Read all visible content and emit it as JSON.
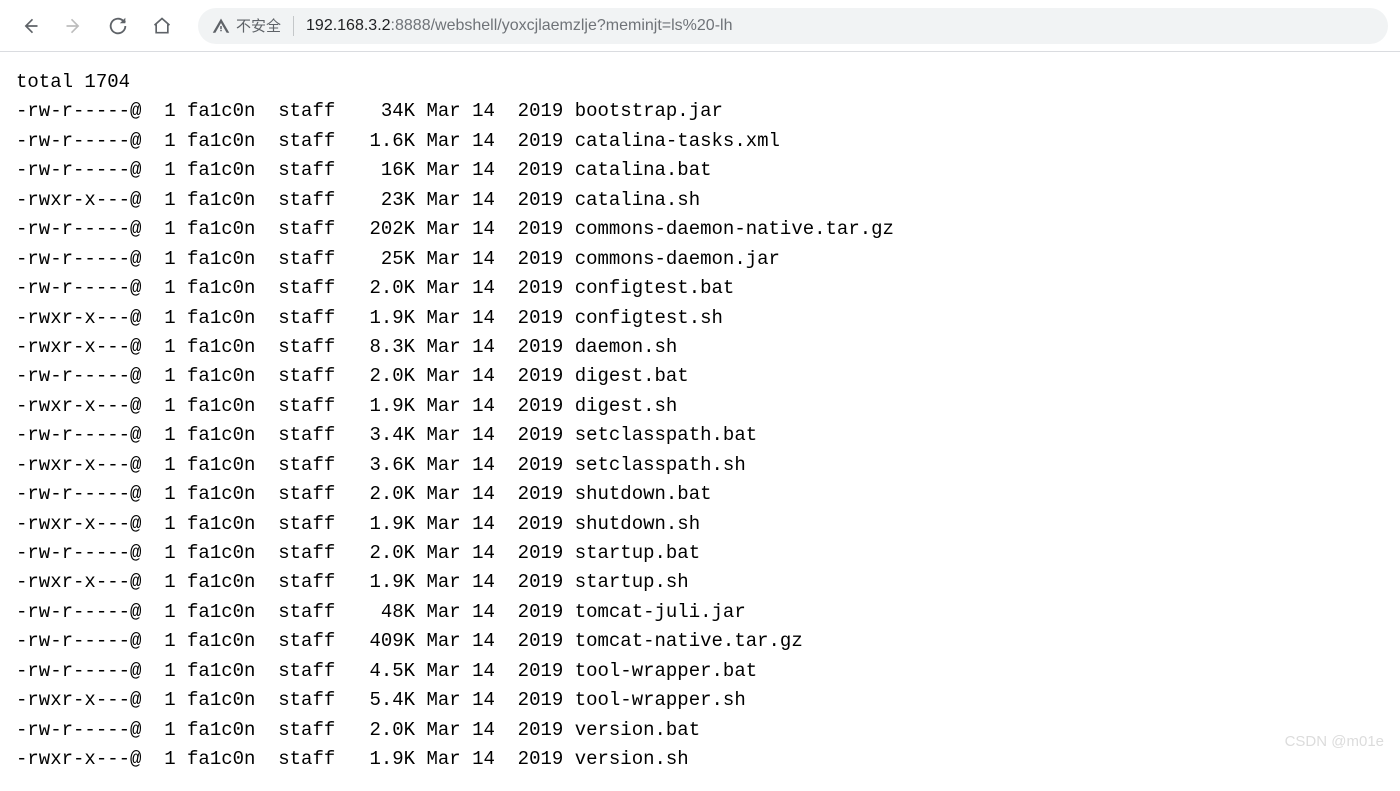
{
  "toolbar": {
    "insecure_label": "不安全",
    "url_host": "192.168.3.2",
    "url_rest": ":8888/webshell/yoxcjlaemzlje?meminjt=ls%20-lh"
  },
  "listing": {
    "total_line": "total 1704",
    "rows": [
      {
        "perm": "-rw-r-----@",
        "links": "1",
        "owner": "fa1c0n",
        "group": "staff",
        "size": "34K",
        "month": "Mar",
        "day": "14",
        "year": "2019",
        "name": "bootstrap.jar"
      },
      {
        "perm": "-rw-r-----@",
        "links": "1",
        "owner": "fa1c0n",
        "group": "staff",
        "size": "1.6K",
        "month": "Mar",
        "day": "14",
        "year": "2019",
        "name": "catalina-tasks.xml"
      },
      {
        "perm": "-rw-r-----@",
        "links": "1",
        "owner": "fa1c0n",
        "group": "staff",
        "size": "16K",
        "month": "Mar",
        "day": "14",
        "year": "2019",
        "name": "catalina.bat"
      },
      {
        "perm": "-rwxr-x---@",
        "links": "1",
        "owner": "fa1c0n",
        "group": "staff",
        "size": "23K",
        "month": "Mar",
        "day": "14",
        "year": "2019",
        "name": "catalina.sh"
      },
      {
        "perm": "-rw-r-----@",
        "links": "1",
        "owner": "fa1c0n",
        "group": "staff",
        "size": "202K",
        "month": "Mar",
        "day": "14",
        "year": "2019",
        "name": "commons-daemon-native.tar.gz"
      },
      {
        "perm": "-rw-r-----@",
        "links": "1",
        "owner": "fa1c0n",
        "group": "staff",
        "size": "25K",
        "month": "Mar",
        "day": "14",
        "year": "2019",
        "name": "commons-daemon.jar"
      },
      {
        "perm": "-rw-r-----@",
        "links": "1",
        "owner": "fa1c0n",
        "group": "staff",
        "size": "2.0K",
        "month": "Mar",
        "day": "14",
        "year": "2019",
        "name": "configtest.bat"
      },
      {
        "perm": "-rwxr-x---@",
        "links": "1",
        "owner": "fa1c0n",
        "group": "staff",
        "size": "1.9K",
        "month": "Mar",
        "day": "14",
        "year": "2019",
        "name": "configtest.sh"
      },
      {
        "perm": "-rwxr-x---@",
        "links": "1",
        "owner": "fa1c0n",
        "group": "staff",
        "size": "8.3K",
        "month": "Mar",
        "day": "14",
        "year": "2019",
        "name": "daemon.sh"
      },
      {
        "perm": "-rw-r-----@",
        "links": "1",
        "owner": "fa1c0n",
        "group": "staff",
        "size": "2.0K",
        "month": "Mar",
        "day": "14",
        "year": "2019",
        "name": "digest.bat"
      },
      {
        "perm": "-rwxr-x---@",
        "links": "1",
        "owner": "fa1c0n",
        "group": "staff",
        "size": "1.9K",
        "month": "Mar",
        "day": "14",
        "year": "2019",
        "name": "digest.sh"
      },
      {
        "perm": "-rw-r-----@",
        "links": "1",
        "owner": "fa1c0n",
        "group": "staff",
        "size": "3.4K",
        "month": "Mar",
        "day": "14",
        "year": "2019",
        "name": "setclasspath.bat"
      },
      {
        "perm": "-rwxr-x---@",
        "links": "1",
        "owner": "fa1c0n",
        "group": "staff",
        "size": "3.6K",
        "month": "Mar",
        "day": "14",
        "year": "2019",
        "name": "setclasspath.sh"
      },
      {
        "perm": "-rw-r-----@",
        "links": "1",
        "owner": "fa1c0n",
        "group": "staff",
        "size": "2.0K",
        "month": "Mar",
        "day": "14",
        "year": "2019",
        "name": "shutdown.bat"
      },
      {
        "perm": "-rwxr-x---@",
        "links": "1",
        "owner": "fa1c0n",
        "group": "staff",
        "size": "1.9K",
        "month": "Mar",
        "day": "14",
        "year": "2019",
        "name": "shutdown.sh"
      },
      {
        "perm": "-rw-r-----@",
        "links": "1",
        "owner": "fa1c0n",
        "group": "staff",
        "size": "2.0K",
        "month": "Mar",
        "day": "14",
        "year": "2019",
        "name": "startup.bat"
      },
      {
        "perm": "-rwxr-x---@",
        "links": "1",
        "owner": "fa1c0n",
        "group": "staff",
        "size": "1.9K",
        "month": "Mar",
        "day": "14",
        "year": "2019",
        "name": "startup.sh"
      },
      {
        "perm": "-rw-r-----@",
        "links": "1",
        "owner": "fa1c0n",
        "group": "staff",
        "size": "48K",
        "month": "Mar",
        "day": "14",
        "year": "2019",
        "name": "tomcat-juli.jar"
      },
      {
        "perm": "-rw-r-----@",
        "links": "1",
        "owner": "fa1c0n",
        "group": "staff",
        "size": "409K",
        "month": "Mar",
        "day": "14",
        "year": "2019",
        "name": "tomcat-native.tar.gz"
      },
      {
        "perm": "-rw-r-----@",
        "links": "1",
        "owner": "fa1c0n",
        "group": "staff",
        "size": "4.5K",
        "month": "Mar",
        "day": "14",
        "year": "2019",
        "name": "tool-wrapper.bat"
      },
      {
        "perm": "-rwxr-x---@",
        "links": "1",
        "owner": "fa1c0n",
        "group": "staff",
        "size": "5.4K",
        "month": "Mar",
        "day": "14",
        "year": "2019",
        "name": "tool-wrapper.sh"
      },
      {
        "perm": "-rw-r-----@",
        "links": "1",
        "owner": "fa1c0n",
        "group": "staff",
        "size": "2.0K",
        "month": "Mar",
        "day": "14",
        "year": "2019",
        "name": "version.bat"
      },
      {
        "perm": "-rwxr-x---@",
        "links": "1",
        "owner": "fa1c0n",
        "group": "staff",
        "size": "1.9K",
        "month": "Mar",
        "day": "14",
        "year": "2019",
        "name": "version.sh"
      }
    ]
  },
  "watermark": "CSDN @m01e"
}
